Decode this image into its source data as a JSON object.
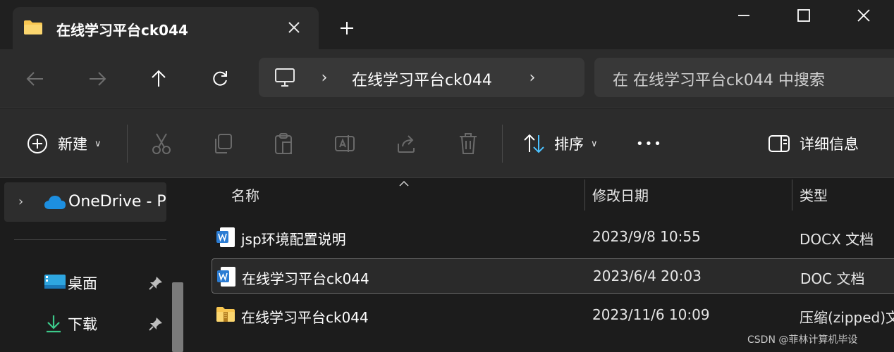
{
  "tab": {
    "title": "在线学习平台ck044",
    "icon": "folder-icon",
    "close_icon": "close-icon"
  },
  "window_controls": [
    "minimize-icon",
    "maximize-icon",
    "close-icon"
  ],
  "nav": {
    "back_icon": "arrow-left-icon",
    "forward_icon": "arrow-right-icon",
    "up_icon": "arrow-up-icon",
    "refresh_icon": "refresh-icon"
  },
  "address": {
    "root_icon": "monitor-icon",
    "separator": "›",
    "crumb": "在线学习平台ck044",
    "trailing": "›"
  },
  "search": {
    "placeholder": "在 在线学习平台ck044 中搜索"
  },
  "command_bar": {
    "new_label": "新建",
    "sort_label": "排序",
    "details_label": "详细信息",
    "more": "•••",
    "icons": [
      "plus-circle-icon",
      "cut-icon",
      "copy-icon",
      "paste-icon",
      "rename-icon",
      "share-icon",
      "delete-icon",
      "sort-icon",
      "details-pane-icon"
    ]
  },
  "sidebar": {
    "onedrive": {
      "label": "OneDrive - Pe",
      "icon": "onedrive-cloud-icon"
    },
    "items": [
      {
        "label": "桌面",
        "icon": "desktop-icon",
        "pinned": true
      },
      {
        "label": "下载",
        "icon": "download-icon",
        "pinned": true
      }
    ]
  },
  "columns": {
    "name": "名称",
    "modified": "修改日期",
    "type": "类型"
  },
  "files": [
    {
      "name": "jsp环境配置说明",
      "modified": "2023/9/8 10:55",
      "type": "DOCX 文档",
      "icon": "word-docx-icon",
      "selected": false
    },
    {
      "name": "在线学习平台ck044",
      "modified": "2023/6/4 20:03",
      "type": "DOC 文档",
      "icon": "word-doc-icon",
      "selected": true
    },
    {
      "name": "在线学习平台ck044",
      "modified": "2023/11/6 10:09",
      "type": "压缩(zipped)文",
      "icon": "zip-folder-icon",
      "selected": false
    }
  ],
  "watermark": "CSDN @菲林计算机毕设",
  "colors": {
    "background": "#1c1c1c",
    "panel": "#2c2c2c",
    "accent_folder": "#f8c651",
    "word_blue": "#2b7cd3",
    "onedrive_blue": "#1d8fe0"
  }
}
